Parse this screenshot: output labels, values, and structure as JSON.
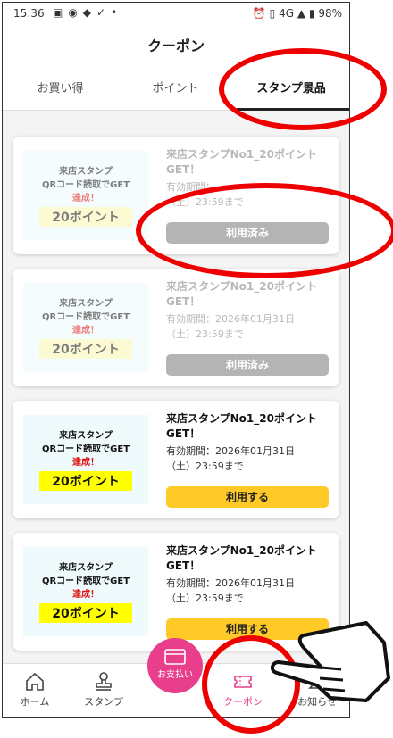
{
  "status_bar": {
    "time": "15:36",
    "network": "4G",
    "battery": "98%"
  },
  "header": {
    "title": "クーポン"
  },
  "tabs": [
    {
      "label": "お買い得"
    },
    {
      "label": "ポイント"
    },
    {
      "label": "スタンプ景品"
    }
  ],
  "coupons": [
    {
      "thumb": {
        "line1": "来店スタンプ",
        "line2": "QRコード読取でGET",
        "line3": "達成！",
        "points": "20ポイント"
      },
      "title": "来店スタンプNo1_20ポイントGET！",
      "valid": "有効期間：",
      "valid_date": "（土）23:59まで",
      "button": "利用済み",
      "state": "used"
    },
    {
      "thumb": {
        "line1": "来店スタンプ",
        "line2": "QRコード読取でGET",
        "line3": "達成！",
        "points": "20ポイント"
      },
      "title": "来店スタンプNo1_20ポイントGET！",
      "valid": "有効期間：2026年01月31日",
      "valid_date": "（土）23:59まで",
      "button": "利用済み",
      "state": "used"
    },
    {
      "thumb": {
        "line1": "来店スタンプ",
        "line2": "QRコード読取でGET",
        "line3": "達成！",
        "points": "20ポイント"
      },
      "title": "来店スタンプNo1_20ポイントGET！",
      "valid": "有効期間：2026年01月31日",
      "valid_date": "（土）23:59まで",
      "button": "利用する",
      "state": "active"
    },
    {
      "thumb": {
        "line1": "来店スタンプ",
        "line2": "QRコード読取でGET",
        "line3": "達成！",
        "points": "20ポイント"
      },
      "title": "来店スタンプNo1_20ポイントGET！",
      "valid": "有効期間：2026年01月31日",
      "valid_date": "（土）23:59まで",
      "button": "利用する",
      "state": "active"
    }
  ],
  "nav": {
    "home": "ホーム",
    "stamp": "スタンプ",
    "pay": "お支払い",
    "coupon": "クーポン",
    "news": "お知らせ"
  },
  "colors": {
    "accent": "#e83e8c",
    "button_active": "#ffca28",
    "button_used": "#b4b4b4",
    "annotation": "#ee0000"
  }
}
